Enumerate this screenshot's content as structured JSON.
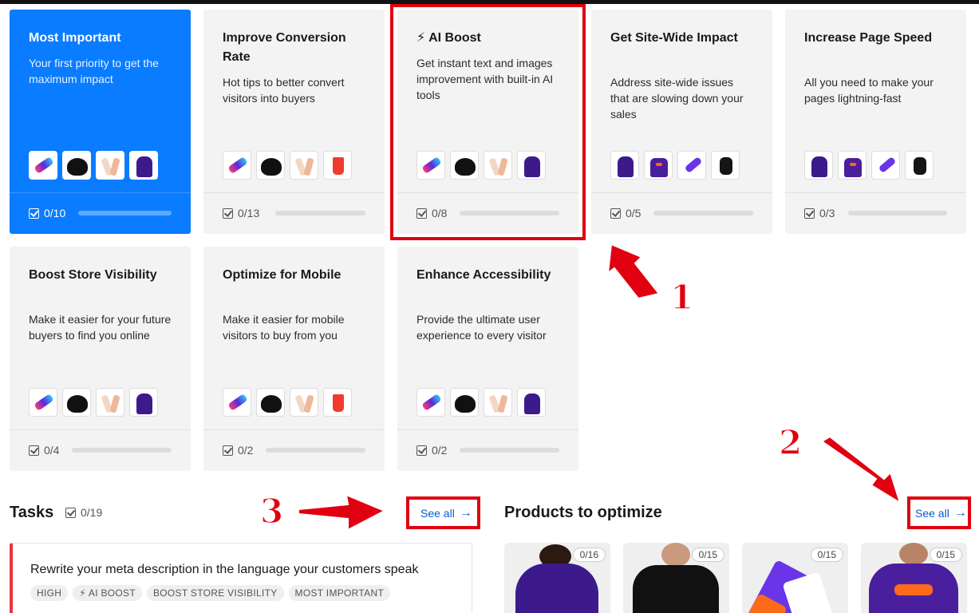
{
  "cards": [
    {
      "title": "Most Important",
      "desc": "Your first priority to get the maximum impact",
      "count": "0/10",
      "active": true
    },
    {
      "title": "Improve Conversion Rate",
      "desc": "Hot tips to better convert visitors into buyers",
      "count": "0/13"
    },
    {
      "title": "⚡ AI Boost",
      "desc": "Get instant text and images improvement with built-in AI tools",
      "count": "0/8"
    },
    {
      "title": "Get Site-Wide Impact",
      "desc": "Address site-wide issues that are slowing down your sales",
      "count": "0/5"
    },
    {
      "title": "Increase Page Speed",
      "desc": "All you need to make your pages lightning-fast",
      "count": "0/3"
    },
    {
      "title": "Boost Store Visibility",
      "desc": "Make it easier for your future buyers to find you online",
      "count": "0/4"
    },
    {
      "title": "Optimize for Mobile",
      "desc": "Make it easier for mobile visitors to buy from you",
      "count": "0/2"
    },
    {
      "title": "Enhance Accessibility",
      "desc": "Provide the ultimate user experience to every visitor",
      "count": "0/2"
    }
  ],
  "annotations": {
    "n1": "1",
    "n2": "2",
    "n3": "3"
  },
  "tasks": {
    "title": "Tasks",
    "count": "0/19",
    "see_all": "See all",
    "first_task": {
      "title": "Rewrite your meta description in the language your customers speak",
      "tags": [
        "HIGH",
        "⚡ AI BOOST",
        "BOOST STORE VISIBILITY",
        "MOST IMPORTANT"
      ]
    }
  },
  "products": {
    "title": "Products to optimize",
    "see_all": "See all",
    "items": [
      {
        "badge": "0/16",
        "image": "purple-hoodie"
      },
      {
        "badge": "0/15",
        "image": "black-polo-shirt"
      },
      {
        "badge": "0/15",
        "image": "gift-card"
      },
      {
        "badge": "0/15",
        "image": "purple-sweatshirt"
      }
    ]
  },
  "colors": {
    "accent": "#0a7cff",
    "annotation": "#e00010",
    "task_priority": "#e8343c",
    "link": "#0a5cc8"
  }
}
